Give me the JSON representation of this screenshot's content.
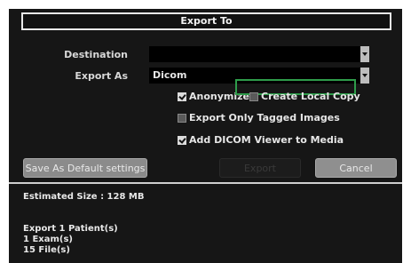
{
  "dialog": {
    "title": "Export To"
  },
  "form": {
    "destination_label": "Destination",
    "destination_value": "",
    "export_as_label": "Export As",
    "export_as_value": "Dicom"
  },
  "options": {
    "anonymize": {
      "label": "Anonymize",
      "checked": true
    },
    "create_local_copy": {
      "label": "Create Local Copy",
      "checked": false,
      "highlight_color": "#2e9c4a"
    },
    "export_only_tagged": {
      "label": "Export Only Tagged Images",
      "checked": false
    },
    "add_dicom_viewer": {
      "label": "Add DICOM Viewer to Media",
      "checked": true
    }
  },
  "buttons": {
    "save_default": "Save As Default settings",
    "export": "Export",
    "cancel": "Cancel"
  },
  "summary": {
    "estimated_size": "Estimated Size : 128 MB",
    "patients": "Export 1 Patient(s)",
    "exams": "1 Exam(s)",
    "files": "15 File(s)"
  },
  "icons": {
    "dropdown": "chevron-down-icon",
    "checkbox": "checkbox-icon"
  }
}
